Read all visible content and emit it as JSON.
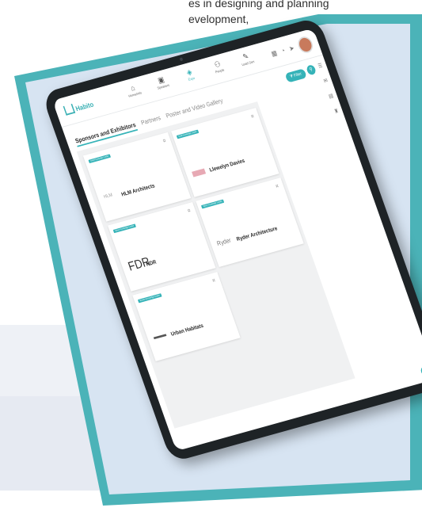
{
  "intro": {
    "line1": "es in designing and planning",
    "line2": "evelopment,"
  },
  "colors": {
    "teal": "#35b3b8",
    "accent": "#3ab0b4"
  },
  "app": {
    "logo": "Habito",
    "nav": [
      {
        "label": "Home/Info",
        "icon": "home-icon"
      },
      {
        "label": "Speakers",
        "icon": "video-icon"
      },
      {
        "label": "Expo",
        "icon": "expo-icon",
        "active": true
      },
      {
        "label": "People",
        "icon": "people-icon"
      },
      {
        "label": "Lead Gen",
        "icon": "lead-icon"
      }
    ],
    "tabs": [
      "Sponsors and Exhibitors",
      "Partners",
      "Poster and Video Gallery"
    ],
    "filter_label": "Filter",
    "cards": [
      {
        "title": "HLM Architects",
        "badge": "Gold Knowledge Leader",
        "logo_text": "HLM"
      },
      {
        "title": "Llewelyn Davies",
        "badge": "Gold Knowledge Leader",
        "logo_text": ""
      },
      {
        "title": "HDR",
        "badge": "Silver Knowledge Leader",
        "logo_text": "FDR"
      },
      {
        "title": "Ryder Architecture",
        "badge": "Silver Knowledge Leader",
        "logo_text": "Ryder"
      },
      {
        "title": "Urban Habitats",
        "badge": "Bronze Knowledge Leader",
        "logo_text": ""
      }
    ]
  }
}
